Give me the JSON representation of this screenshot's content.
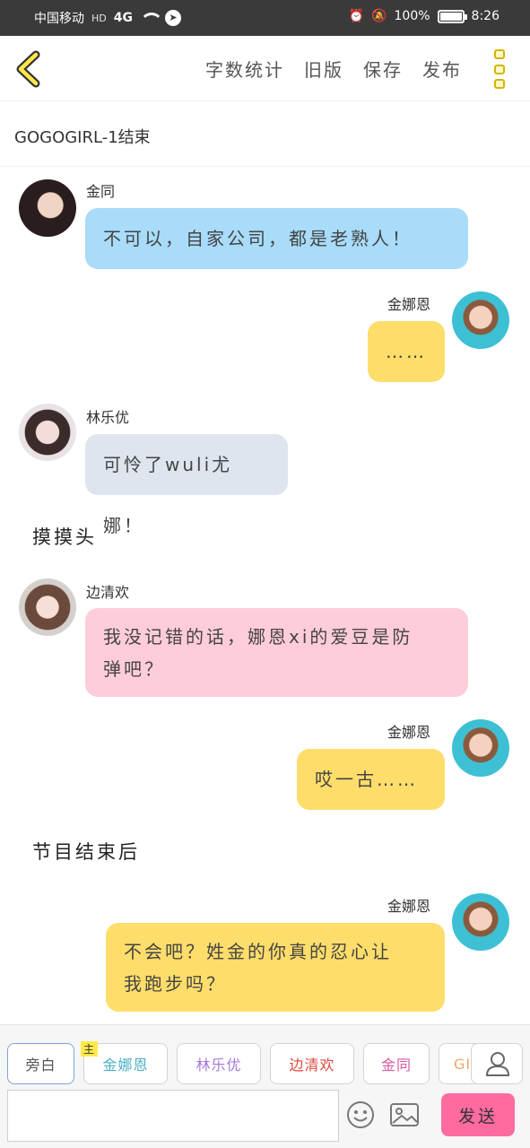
{
  "status_bar": {
    "carrier": "中国移动",
    "hd": "HD",
    "network": "4G",
    "battery_percent": "100%",
    "time": "8:26"
  },
  "toolbar": {
    "actions": [
      "字数统计",
      "旧版",
      "保存",
      "发布"
    ]
  },
  "title": "GOGOGIRL-1结束",
  "messages": [
    {
      "name": "金同",
      "text": "不可以，自家公司，都是老熟人！",
      "color": "#a8dcfa"
    },
    {
      "name": "金娜恩",
      "text": "……",
      "color": "#ffdd6b"
    },
    {
      "name": "林乐优",
      "text": "可怜了wuli尤娜！",
      "color": "#dfe5ee"
    },
    {
      "narration": "摸摸头"
    },
    {
      "name": "边清欢",
      "text_line1": "我没记错的话，娜恩xi的爱豆是防",
      "text_line2": "弹吧？",
      "color": "#ffcdda"
    },
    {
      "name": "金娜恩",
      "text": "哎一古……",
      "color": "#ffdd6b"
    },
    {
      "narration": "节目结束后"
    },
    {
      "name": "金娜恩",
      "text_line1": "不会吧？姓金的你真的忍心让",
      "text_line2": "我跑步吗？",
      "color": "#ffdd6b"
    }
  ],
  "bottom": {
    "chips": [
      {
        "label": "旁白",
        "color": "#555555"
      },
      {
        "label": "金娜恩",
        "color": "#4ab0c5",
        "tag": "主"
      },
      {
        "label": "林乐优",
        "color": "#a57ad8"
      },
      {
        "label": "边清欢",
        "color": "#e0483c"
      },
      {
        "label": "金同",
        "color": "#d85aa0"
      },
      {
        "label": "GIF",
        "color": "#f2a36a"
      }
    ],
    "send_label": "发送"
  }
}
